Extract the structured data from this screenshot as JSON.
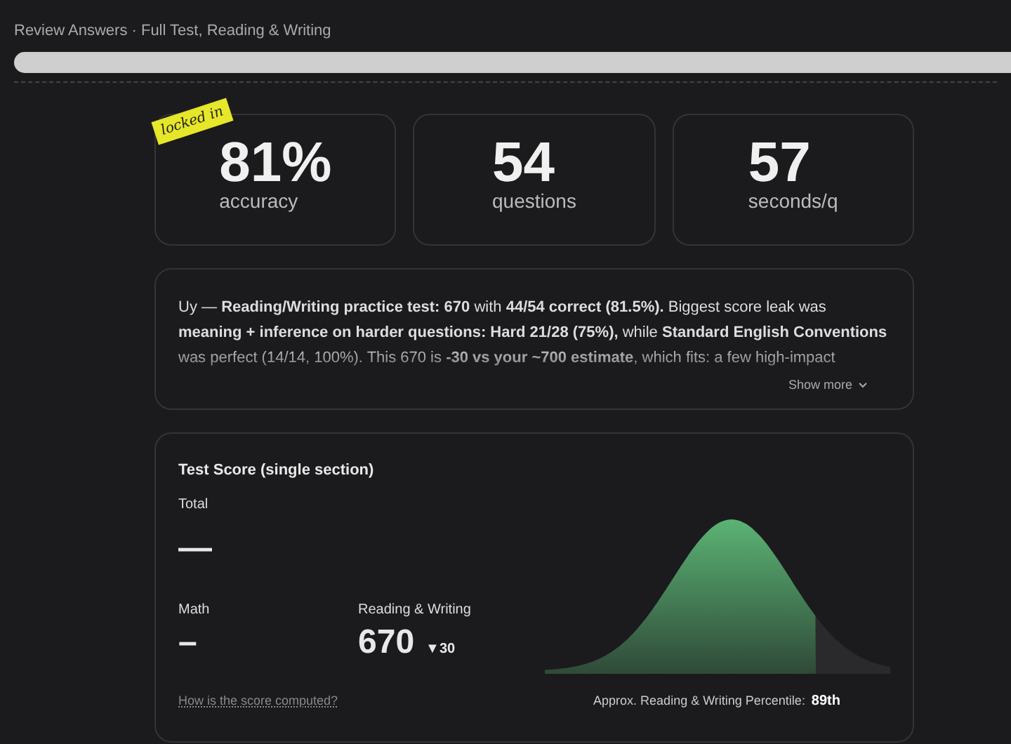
{
  "page": {
    "title": "Review Answers · Full Test, Reading & Writing"
  },
  "stats": [
    {
      "value": "81%",
      "label": "accuracy",
      "sticker": "locked in"
    },
    {
      "value": "54",
      "label": "questions"
    },
    {
      "value": "57",
      "label": "seconds/q"
    }
  ],
  "summary": {
    "text": "Uy — **Reading/Writing practice test: 670** with **44/54 correct (81.5%).** Biggest score leak was **meaning + inference on harder questions: Hard 21/28 (75%),** while **Standard English Conventions** was perfect (14/14, 100%). This 670 is **-30 vs your ~700 estimate**, which fits: a few high-impact",
    "expanded": false,
    "toggle": "Show more"
  },
  "score": {
    "title": "Test Score (single section)",
    "total_label": "Total",
    "total_value": "—",
    "sections": [
      {
        "label": "Math",
        "value": "–"
      },
      {
        "label": "Reading & Writing",
        "value": "670",
        "delta": "▼30"
      }
    ],
    "help_link": "How is the score computed?",
    "percentile_label": "Approx. Reading & Writing Percentile:",
    "percentile": "89th"
  }
}
